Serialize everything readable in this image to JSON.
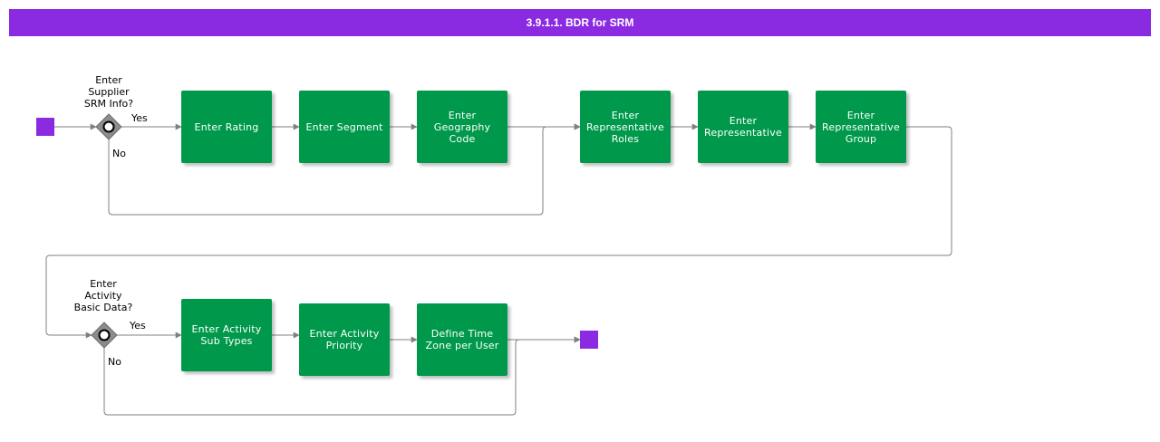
{
  "title": "3.9.1.1. BDR for SRM",
  "colors": {
    "header": "#8a2be2",
    "task": "#00994c",
    "terminal": "#8a2be2",
    "gateway": "#8c8c8c",
    "connector": "#808080"
  },
  "gateways": [
    {
      "question": "Enter\nSupplier\nSRM Info?",
      "yes": "Yes",
      "no": "No"
    },
    {
      "question": "Enter\nActivity\nBasic Data?",
      "yes": "Yes",
      "no": "No"
    }
  ],
  "tasks": [
    "Enter Rating",
    "Enter Segment",
    "Enter\nGeography\nCode",
    "Enter\nRepresentative\nRoles",
    "Enter\nRepresentative",
    "Enter\nRepresentative\nGroup",
    "Enter Activity\nSub Types",
    "Enter Activity\nPriority",
    "Define Time\nZone per User"
  ]
}
